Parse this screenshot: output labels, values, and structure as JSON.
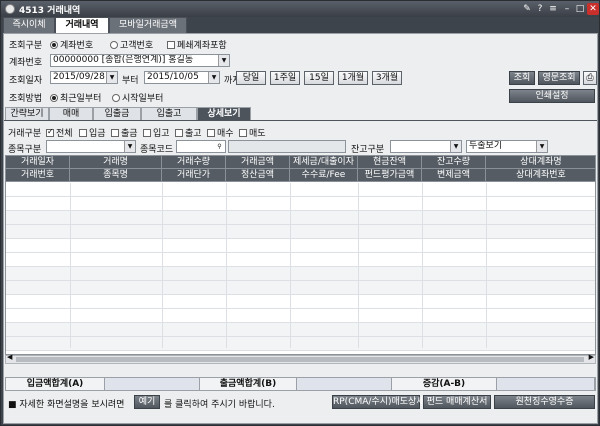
{
  "title_bar": {
    "title": "4513 거래내역",
    "icons": [
      "pin-icon",
      "help-icon",
      "menu-icon",
      "minimize-icon",
      "maximize-icon",
      "close-icon"
    ]
  },
  "top_tabs": [
    "즉시이체",
    "거래내역",
    "모바일거래금액"
  ],
  "filters": {
    "inquiry_type_label": "조회구분",
    "inquiry_options": [
      "계좌번호",
      "고객번호"
    ],
    "include_closed_label": "폐쇄계좌포함",
    "account_label": "계좌번호",
    "account_value": "00000000 [종합(은행연계)] 홍길동",
    "date_label": "조회일자",
    "date_from": "2015/09/28",
    "date_sep": "부터",
    "date_to": "2015/10/05",
    "date_end": "까지",
    "period_buttons": [
      "당일",
      "1주일",
      "15일",
      "1개월",
      "3개월"
    ],
    "method_label": "조회방법",
    "method_options": [
      "최근일부터",
      "시작일부터"
    ],
    "search_button": "조회",
    "english_search_button": "영문조회",
    "print_settings_button": "인쇄설정"
  },
  "sub_tabs": [
    "간략보기",
    "매매",
    "입출금",
    "입출고",
    "상세보기"
  ],
  "detail_filters": {
    "trade_type_label": "거래구분",
    "trade_types": [
      {
        "label": "전체",
        "checked": true
      },
      {
        "label": "입금",
        "checked": false
      },
      {
        "label": "출금",
        "checked": false
      },
      {
        "label": "입고",
        "checked": false
      },
      {
        "label": "출고",
        "checked": false
      },
      {
        "label": "매수",
        "checked": false
      },
      {
        "label": "매도",
        "checked": false
      }
    ],
    "item_type_label": "종목구분",
    "item_code_label": "종목코드",
    "balance_type_label": "잔고구분",
    "view_mode": "두줄보기"
  },
  "grid": {
    "header_row1": [
      "거래일자",
      "거래명",
      "거래수량",
      "거래금액",
      "제세금/대출이자",
      "현금잔액",
      "잔고수량",
      "상대계좌명"
    ],
    "header_row2": [
      "거래번호",
      "종목명",
      "거래단가",
      "정산금액",
      "수수료/Fee",
      "펀드평가금액",
      "변제금액",
      "상대계좌번호"
    ]
  },
  "summary": {
    "deposit_total_label": "입금액합계(A)",
    "withdraw_total_label": "출금액합계(B)",
    "diff_label": "증감(A-B)"
  },
  "footer": {
    "info_text": "■ 자세한 화면설명을 보시려면",
    "example_button": "예기",
    "info_suffix": "를 클릭하여 주시기 바랍니다.",
    "rp_button": "RP(CMA/수시)매도상세",
    "fund_button": "펀드 매매계산서",
    "tax_button": "원천징수영수증"
  }
}
